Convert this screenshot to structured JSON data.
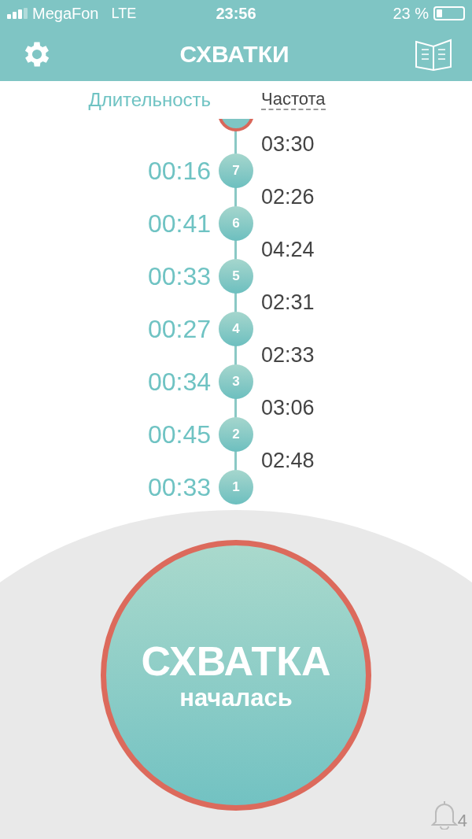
{
  "status_bar": {
    "carrier": "MegaFon",
    "network": "LTE",
    "time": "23:56",
    "battery_text": "23 %"
  },
  "header": {
    "title": "СХВАТКИ"
  },
  "column_headers": {
    "duration": "Длительность",
    "frequency": "Частота"
  },
  "contractions": [
    {
      "number": "7",
      "duration": "00:16",
      "interval": "03:30"
    },
    {
      "number": "6",
      "duration": "00:41",
      "interval": "02:26"
    },
    {
      "number": "5",
      "duration": "00:33",
      "interval": "04:24"
    },
    {
      "number": "4",
      "duration": "00:27",
      "interval": "02:31"
    },
    {
      "number": "3",
      "duration": "00:34",
      "interval": "02:33"
    },
    {
      "number": "2",
      "duration": "00:45",
      "interval": "03:06"
    },
    {
      "number": "1",
      "duration": "00:33",
      "interval": "02:48"
    }
  ],
  "main_button": {
    "title": "СХВАТКА",
    "subtitle": "началась"
  },
  "notifications": {
    "count": "4"
  }
}
